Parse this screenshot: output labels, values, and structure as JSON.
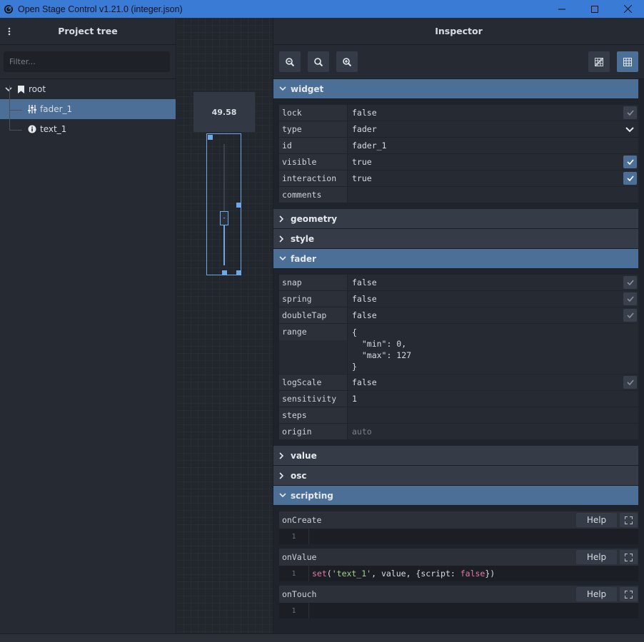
{
  "window": {
    "title": "Open Stage Control v1.21.0 (integer.json)"
  },
  "project_tree": {
    "header": "Project tree",
    "filter_placeholder": "Filter...",
    "nodes": [
      {
        "label": "root",
        "icon": "bookmark-icon"
      },
      {
        "label": "fader_1",
        "icon": "sliders-icon",
        "selected": true
      },
      {
        "label": "text_1",
        "icon": "info-icon"
      }
    ]
  },
  "canvas": {
    "text_widget_value": "49.58",
    "fader_knob_label": "-",
    "fader_value": 49.58,
    "fader_range": [
      0,
      127
    ]
  },
  "inspector": {
    "header": "Inspector",
    "sections": {
      "widget": {
        "title": "widget",
        "props": [
          {
            "name": "lock",
            "value": "false",
            "checkbox": "off"
          },
          {
            "name": "type",
            "value": "fader",
            "select": true
          },
          {
            "name": "id",
            "value": "fader_1"
          },
          {
            "name": "visible",
            "value": "true",
            "checkbox": "on"
          },
          {
            "name": "interaction",
            "value": "true",
            "checkbox": "on"
          },
          {
            "name": "comments",
            "value": ""
          }
        ]
      },
      "geometry": {
        "title": "geometry"
      },
      "style": {
        "title": "style"
      },
      "fader": {
        "title": "fader",
        "props": [
          {
            "name": "snap",
            "value": "false",
            "checkbox": "off"
          },
          {
            "name": "spring",
            "value": "false",
            "checkbox": "off"
          },
          {
            "name": "doubleTap",
            "value": "false",
            "checkbox": "off"
          },
          {
            "name": "range",
            "value": "{\n  \"min\": 0,\n  \"max\": 127\n}"
          },
          {
            "name": "logScale",
            "value": "false",
            "checkbox": "off"
          },
          {
            "name": "sensitivity",
            "value": "1"
          },
          {
            "name": "steps",
            "value": ""
          },
          {
            "name": "origin",
            "value": "auto",
            "dim": true
          }
        ]
      },
      "value": {
        "title": "value"
      },
      "osc": {
        "title": "osc"
      },
      "scripting": {
        "title": "scripting",
        "help_label": "Help",
        "scripts": [
          {
            "name": "onCreate",
            "line": "1",
            "code_fn": "",
            "code_str": "",
            "code_mid": "",
            "code_kw": "",
            "code_end": ""
          },
          {
            "name": "onValue",
            "line": "1",
            "code_fn": "set",
            "code_open": "(",
            "code_str": "'text_1'",
            "code_mid": ", value, {script: ",
            "code_kw": "false",
            "code_end": "})"
          },
          {
            "name": "onTouch",
            "line": "1",
            "code_fn": "",
            "code_str": "",
            "code_mid": "",
            "code_kw": "",
            "code_end": ""
          }
        ]
      }
    }
  }
}
